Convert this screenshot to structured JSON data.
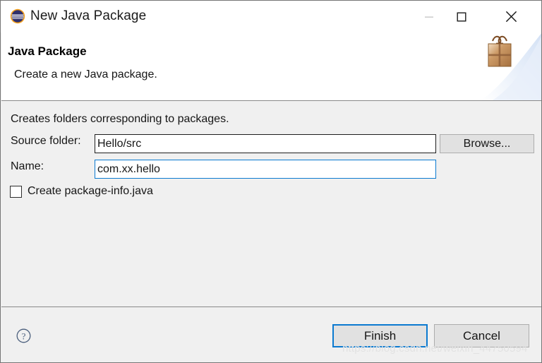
{
  "window": {
    "title": "New Java Package",
    "app_icon": "eclipse-icon",
    "controls": {
      "minimize": "minimize-icon",
      "maximize": "maximize-icon",
      "close": "close-icon"
    }
  },
  "header": {
    "title": "Java Package",
    "description": "Create a new Java package.",
    "banner_icon": "gift-package-icon"
  },
  "content": {
    "intro": "Creates folders corresponding to packages.",
    "source_folder": {
      "label": "Source folder:",
      "value": "Hello/src",
      "placeholder": ""
    },
    "name": {
      "label": "Name:",
      "value": "com.xx.hello",
      "placeholder": ""
    },
    "browse_label": "Browse...",
    "create_package_info": {
      "label": "Create package-info.java",
      "checked": false
    }
  },
  "footer": {
    "help_icon": "help-icon",
    "finish_label": "Finish",
    "cancel_label": "Cancel"
  },
  "watermark": "https://blog.csdn.net/weixin_44750594",
  "colors": {
    "focus_blue": "#0b7ad0",
    "dialog_bg": "#f0f0f0",
    "header_bg": "#ffffff",
    "button_bg": "#e1e1e1",
    "border_gray": "#adadad"
  }
}
